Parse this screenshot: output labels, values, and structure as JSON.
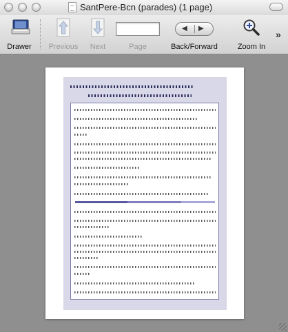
{
  "window": {
    "title": "SantPere-Bcn (parades) (1 page)"
  },
  "toolbar": {
    "drawer_label": "Drawer",
    "previous_label": "Previous",
    "next_label": "Next",
    "page_label": "Page",
    "page_value": "",
    "back_forward_label": "Back/Forward",
    "zoom_in_label": "Zoom In",
    "overflow_glyph": "»"
  },
  "icons": {
    "drawer": "drawer-icon",
    "previous": "up-arrow-icon",
    "next": "down-arrow-icon",
    "back": "left-arrow-icon",
    "forward": "right-arrow-icon",
    "zoom": "magnifier-plus-icon"
  },
  "colors": {
    "content_bg": "#8f8f8f",
    "doc_panel": "#d8d8e8",
    "doc_border": "#7a7aa8",
    "rule_dark": "#5a5aa0",
    "rule_light": "#a8a8d8"
  }
}
